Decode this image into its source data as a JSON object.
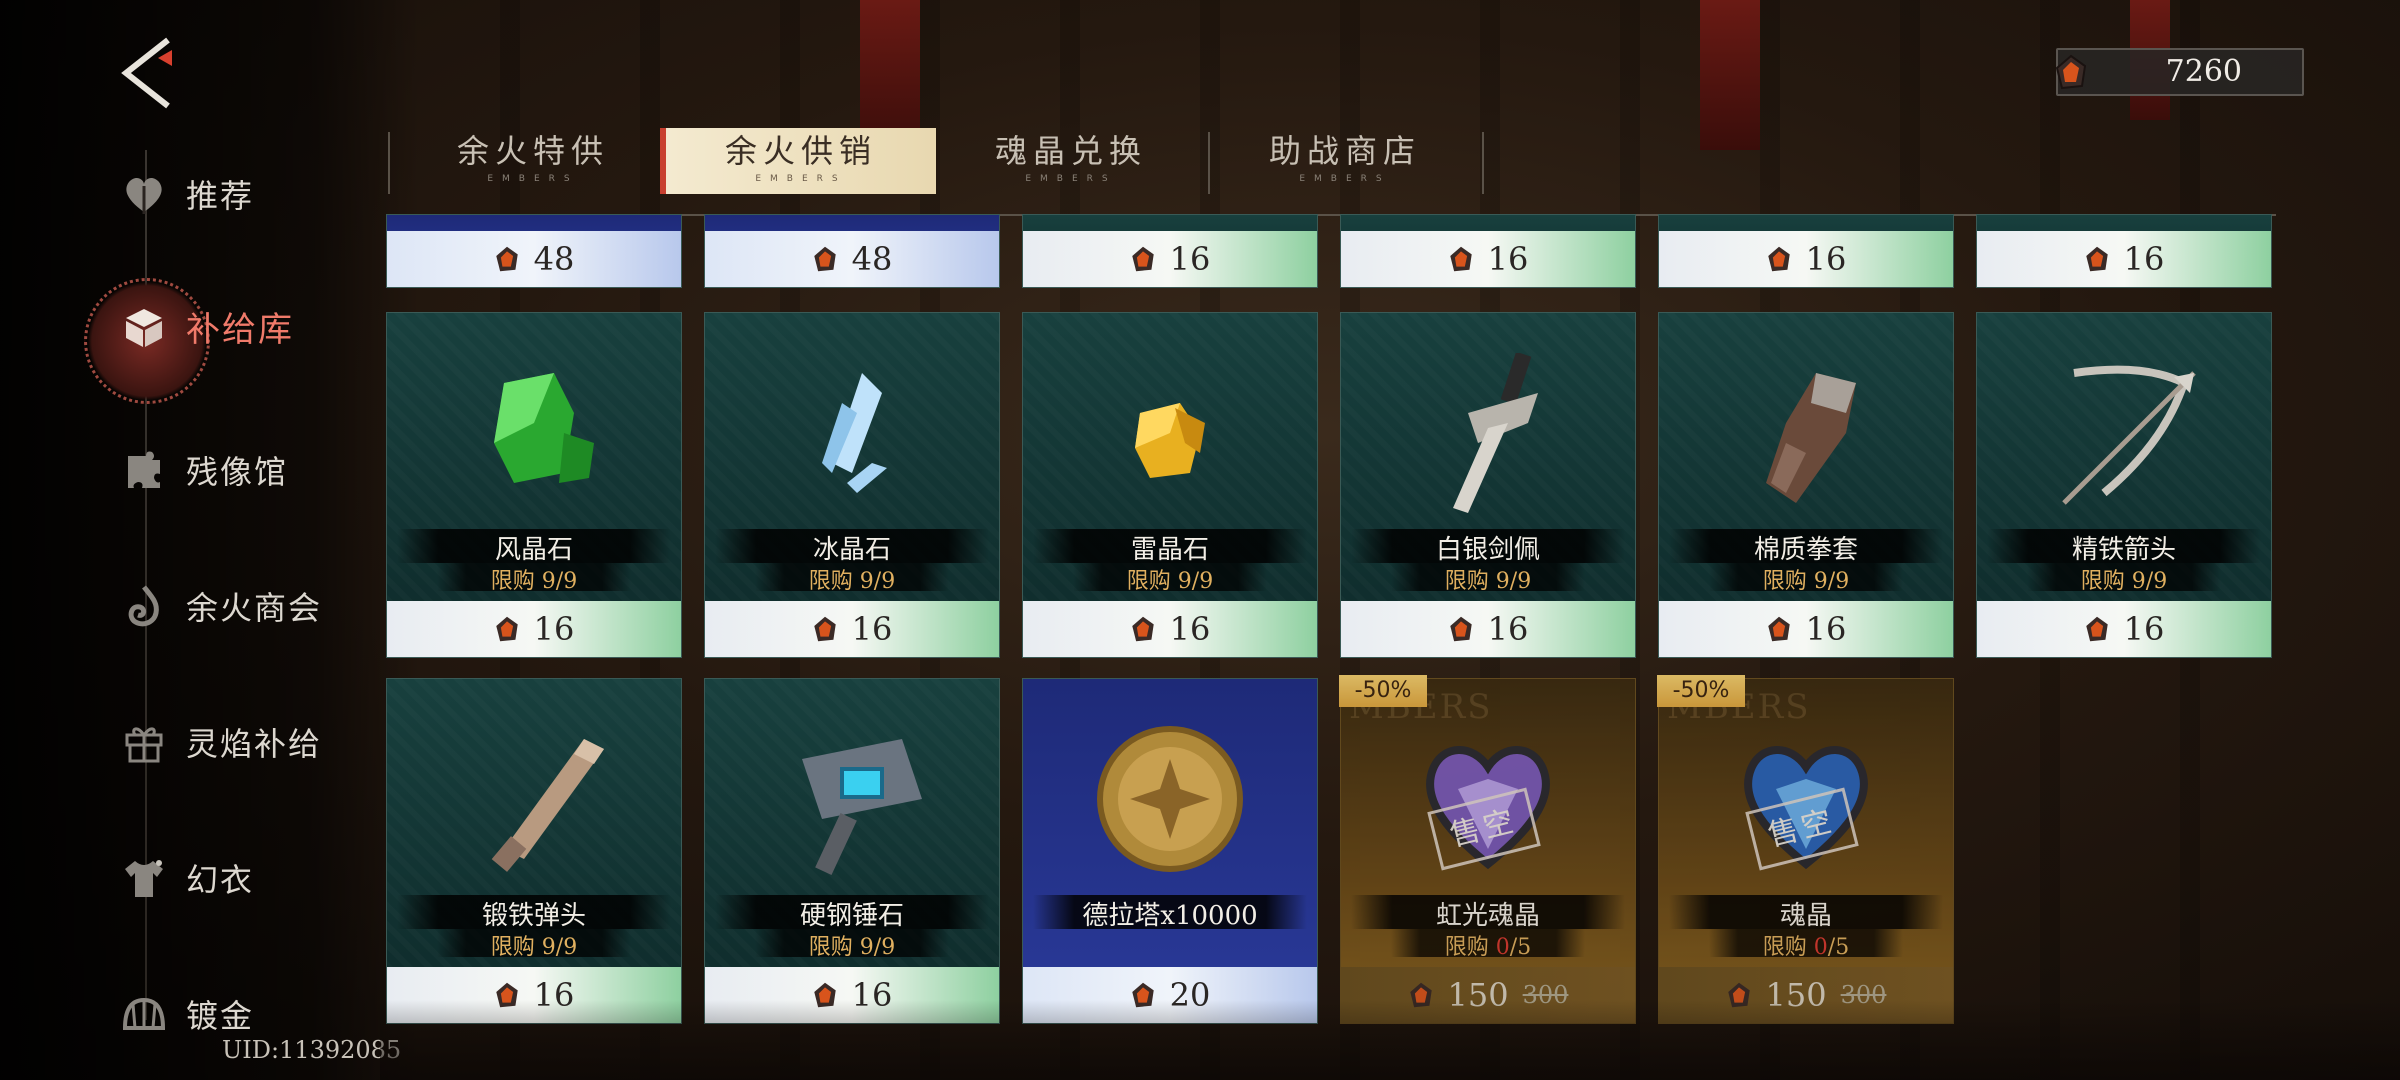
{
  "currency": {
    "icon": "ember-crystal-icon",
    "amount": "7260"
  },
  "uid": "UID:11392085",
  "sidebar": {
    "items": [
      {
        "label": "推荐",
        "icon": "heart-leaf-icon"
      },
      {
        "label": "补给库",
        "icon": "supply-box-icon",
        "active": true
      },
      {
        "label": "残像馆",
        "icon": "puzzle-icon"
      },
      {
        "label": "余火商会",
        "icon": "flame-swirl-icon"
      },
      {
        "label": "灵焰补给",
        "icon": "gift-icon"
      },
      {
        "label": "幻衣",
        "icon": "shirt-icon"
      },
      {
        "label": "镀金",
        "icon": "shell-icon"
      }
    ]
  },
  "tabs": [
    {
      "label": "余火特供",
      "sub": "EMBERS"
    },
    {
      "label": "余火供销",
      "sub": "EMBERS",
      "active": true
    },
    {
      "label": "魂晶兑换",
      "sub": "EMBERS"
    },
    {
      "label": "助战商店",
      "sub": "EMBERS"
    }
  ],
  "top_row": [
    {
      "price": "48"
    },
    {
      "price": "48"
    },
    {
      "price": "16"
    },
    {
      "price": "16"
    },
    {
      "price": "16"
    },
    {
      "price": "16"
    }
  ],
  "items_row2": [
    {
      "name": "风晶石",
      "limit_label": "限购",
      "limit": "9/9",
      "price": "16",
      "icon": "green-crystal-icon"
    },
    {
      "name": "冰晶石",
      "limit_label": "限购",
      "limit": "9/9",
      "price": "16",
      "icon": "ice-crystal-icon"
    },
    {
      "name": "雷晶石",
      "limit_label": "限购",
      "limit": "9/9",
      "price": "16",
      "icon": "gold-crystal-icon"
    },
    {
      "name": "白银剑佩",
      "limit_label": "限购",
      "limit": "9/9",
      "price": "16",
      "icon": "sword-hilt-icon"
    },
    {
      "name": "棉质拳套",
      "limit_label": "限购",
      "limit": "9/9",
      "price": "16",
      "icon": "gauntlet-icon"
    },
    {
      "name": "精铁箭头",
      "limit_label": "限购",
      "limit": "9/9",
      "price": "16",
      "icon": "bow-arrow-icon"
    }
  ],
  "items_row3": [
    {
      "name": "锻铁弹头",
      "limit_label": "限购",
      "limit": "9/9",
      "price": "16",
      "icon": "bullet-icon"
    },
    {
      "name": "硬钢锤石",
      "limit_label": "限购",
      "limit": "9/9",
      "price": "16",
      "icon": "hammer-icon"
    },
    {
      "name": "德拉塔x10000",
      "price": "20",
      "icon": "gold-coin-icon"
    },
    {
      "name": "虹光魂晶",
      "limit_label": "限购",
      "limit_used": "0",
      "limit_total": "/5",
      "price": "150",
      "orig_price": "300",
      "discount": "-50%",
      "sold_out": "售空",
      "watermark": "MBERS",
      "icon": "purple-heart-gem-icon"
    },
    {
      "name": "魂晶",
      "limit_label": "限购",
      "limit_used": "0",
      "limit_total": "/5",
      "price": "150",
      "orig_price": "300",
      "discount": "-50%",
      "sold_out": "售空",
      "watermark": "MBERS",
      "icon": "blue-heart-gem-icon"
    }
  ],
  "colors": {
    "accent_red": "#c84030",
    "limit_gold": "#e0b060",
    "active_nav": "#f07a6a"
  }
}
